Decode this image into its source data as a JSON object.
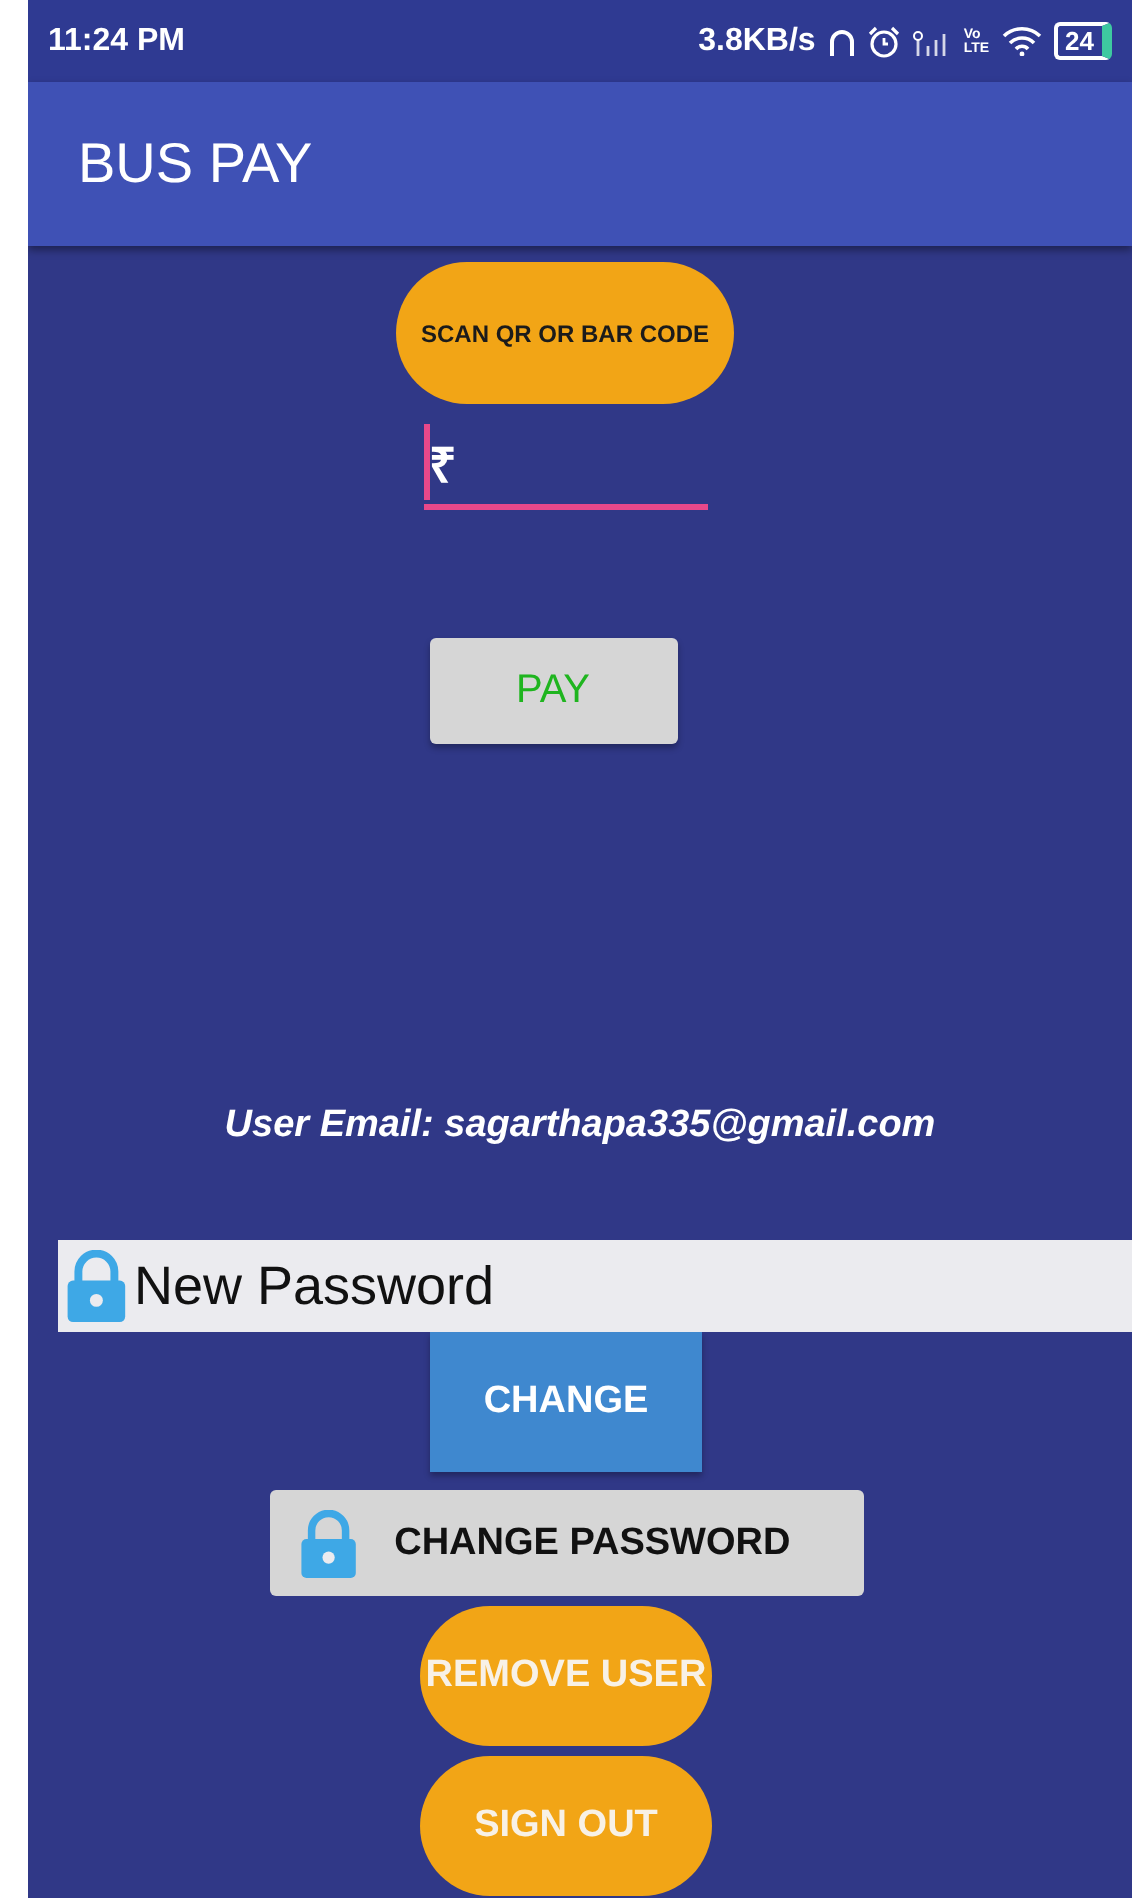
{
  "status_bar": {
    "time": "11:24 PM",
    "speed": "3.8KB/s",
    "network_label_top": "Vo",
    "network_label_bottom": "LTE",
    "battery": "24"
  },
  "app_bar": {
    "title": "BUS PAY"
  },
  "scan_button": "SCAN QR OR BAR CODE",
  "amount_field": {
    "prefix": "₹",
    "focused": true
  },
  "pay_button": "PAY",
  "user_email": "User Email: sagarthapa335@gmail.com",
  "password_field": {
    "placeholder": "New Password"
  },
  "buttons": [
    {
      "kind": "flat",
      "label": "CHANGE"
    },
    {
      "kind": "icon",
      "label": "CHANGE PASSWORD"
    },
    {
      "kind": "pill",
      "label": "REMOVE USER"
    },
    {
      "kind": "pill",
      "label": "SIGN OUT"
    }
  ]
}
